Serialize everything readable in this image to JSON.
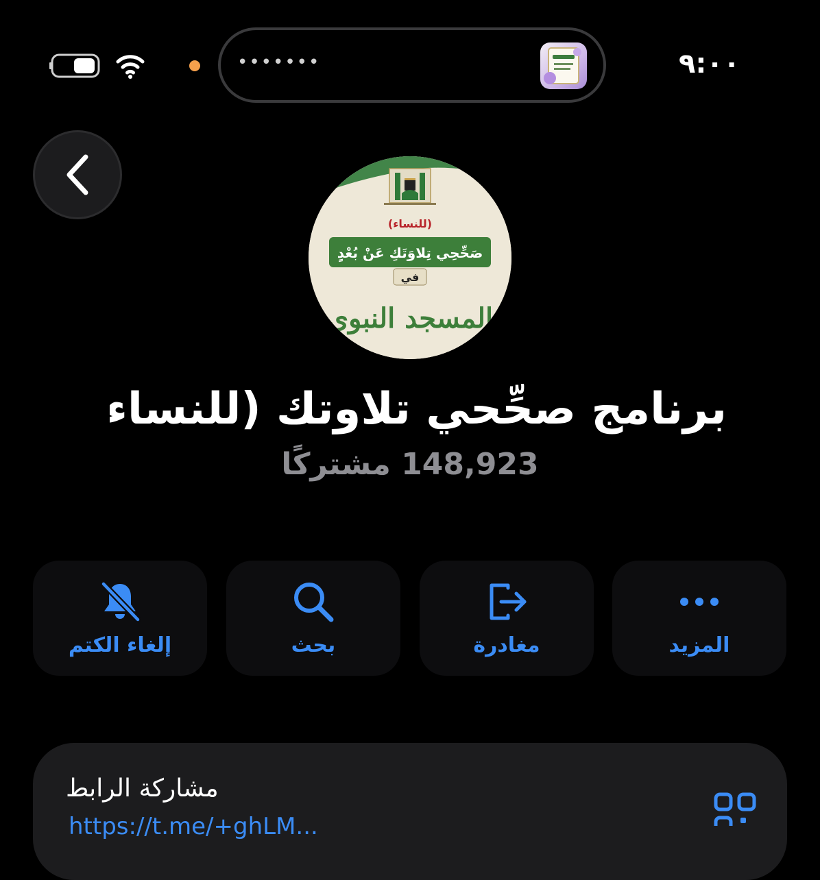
{
  "status_bar": {
    "time": "٩:٠٠",
    "dynamic_island_text": "•••••••"
  },
  "channel": {
    "title": "برنامج صحِّحي تلاوتك (للنساء)",
    "subscribers": "148,923 مشتركًا",
    "avatar_text": {
      "badge": "(للنساء)",
      "banner": "صَحِّحِي تِلاوَتَكِ عَنْ بُعْدٍ",
      "fi": "في",
      "mosque": "المسجد النبوي"
    }
  },
  "actions": [
    {
      "label": "إلغاء الكتم",
      "icon": "bell-slash-icon"
    },
    {
      "label": "بحث",
      "icon": "search-icon"
    },
    {
      "label": "مغادرة",
      "icon": "leave-icon"
    },
    {
      "label": "المزيد",
      "icon": "more-icon"
    }
  ],
  "share": {
    "label": "مشاركة الرابط",
    "link": "https://t.me/+ghLM..."
  },
  "colors": {
    "accent": "#3b8cf5",
    "background": "#000000",
    "card": "#1c1c1e",
    "notification_dot": "#f6a04c",
    "secondary_text": "#8e8e93"
  }
}
